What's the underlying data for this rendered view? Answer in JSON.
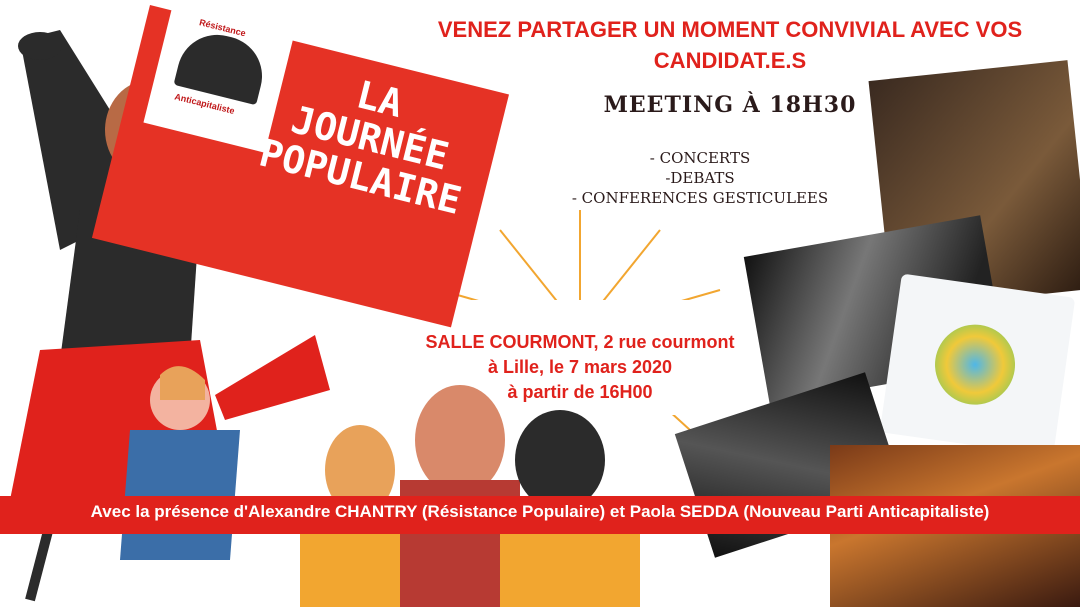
{
  "headline": "VENEZ PARTAGER UN MOMENT CONVIVIAL AVEC VOS CANDIDAT.E.S",
  "meeting": "MEETING À 18H30",
  "activities": [
    "- CONCERTS",
    "-DEBATS",
    "- CONFERENCES GESTICULEES"
  ],
  "venue": {
    "line1": "SALLE COURMONT, 2 rue courmont",
    "line2": "à Lille, le  7 mars 2020",
    "line3": "à partir de 16H00"
  },
  "sign": {
    "line1": "LA",
    "line2": "JOURNÉE",
    "line3": "POPULAIRE"
  },
  "logo": {
    "line1": "Résistance",
    "line2": "Anticapitaliste"
  },
  "banner": "Avec la présence d'Alexandre CHANTRY (Résistance Populaire) et Paola SEDDA (Nouveau Parti Anticapitaliste)",
  "colors": {
    "accent": "#e0221c",
    "sign": "#e53225"
  }
}
